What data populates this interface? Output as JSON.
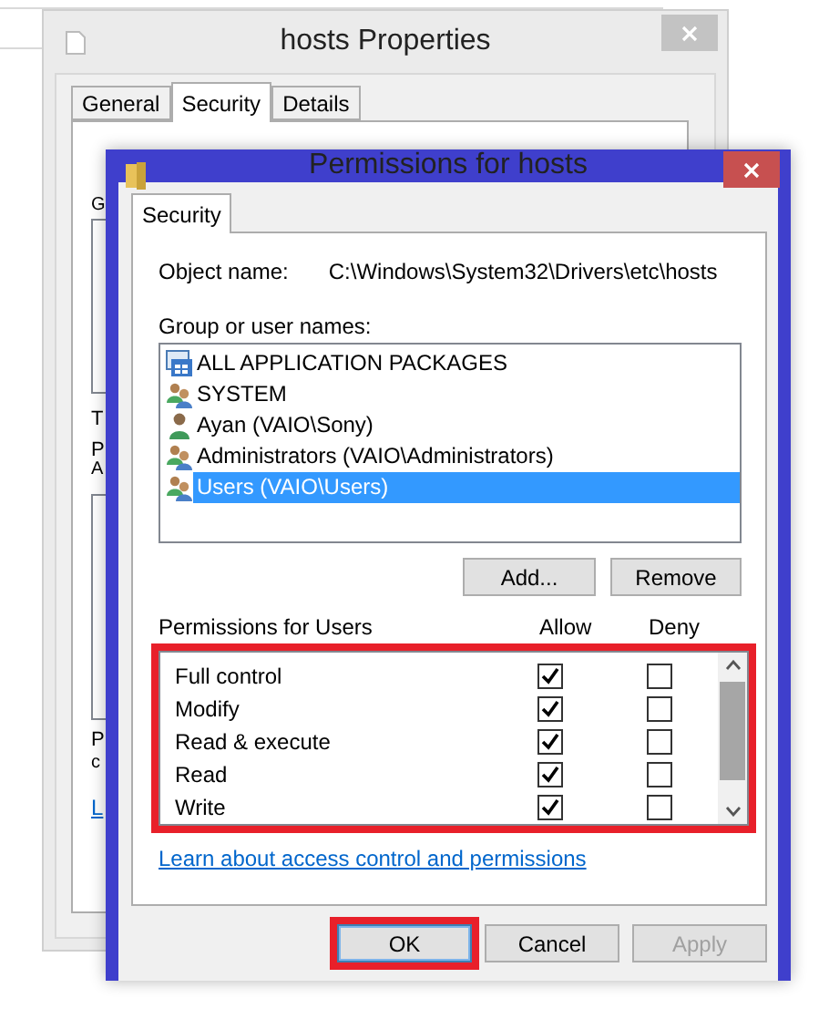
{
  "background_window": {
    "title": "hosts Properties",
    "tabs": [
      {
        "label": "General",
        "selected": false
      },
      {
        "label": "Security",
        "selected": true
      },
      {
        "label": "Details",
        "selected": false
      }
    ],
    "fragments": [
      {
        "text": "G",
        "kind": "label"
      },
      {
        "kind": "list"
      },
      {
        "text": "T",
        "kind": "label"
      },
      {
        "text": "P",
        "kind": "label"
      },
      {
        "text": "A",
        "kind": "small"
      },
      {
        "kind": "list"
      },
      {
        "text": "P",
        "kind": "label"
      },
      {
        "text": "c",
        "kind": "small"
      },
      {
        "text": "L",
        "kind": "link"
      }
    ]
  },
  "dialog": {
    "title": "Permissions for hosts",
    "tabs": [
      {
        "label": "Security",
        "selected": true
      }
    ],
    "object_name_label": "Object name:",
    "object_name": "C:\\Windows\\System32\\Drivers\\etc\\hosts",
    "groups_label": "Group or user names:",
    "groups": [
      {
        "name": "ALL APPLICATION PACKAGES",
        "kind": "package",
        "selected": false
      },
      {
        "name": "SYSTEM",
        "kind": "group",
        "selected": false
      },
      {
        "name": "Ayan (VAIO\\Sony)",
        "kind": "user",
        "selected": false
      },
      {
        "name": "Administrators (VAIO\\Administrators)",
        "kind": "group",
        "selected": false
      },
      {
        "name": "Users (VAIO\\Users)",
        "kind": "group",
        "selected": true
      }
    ],
    "group_buttons": [
      "Add...",
      "Remove"
    ],
    "permissions_label": "Permissions for Users",
    "allow_label": "Allow",
    "deny_label": "Deny",
    "permissions_highlighted": true,
    "permissions": [
      {
        "name": "Full control",
        "allow": true,
        "deny": false
      },
      {
        "name": "Modify",
        "allow": true,
        "deny": false
      },
      {
        "name": "Read & execute",
        "allow": true,
        "deny": false
      },
      {
        "name": "Read",
        "allow": true,
        "deny": false
      },
      {
        "name": "Write",
        "allow": true,
        "deny": false
      }
    ],
    "link": "Learn about access control and permissions",
    "buttons": [
      {
        "label": "OK",
        "default": true,
        "highlighted": true,
        "disabled": false
      },
      {
        "label": "Cancel",
        "default": false,
        "highlighted": false,
        "disabled": false
      },
      {
        "label": "Apply",
        "default": false,
        "highlighted": false,
        "disabled": true
      }
    ]
  }
}
